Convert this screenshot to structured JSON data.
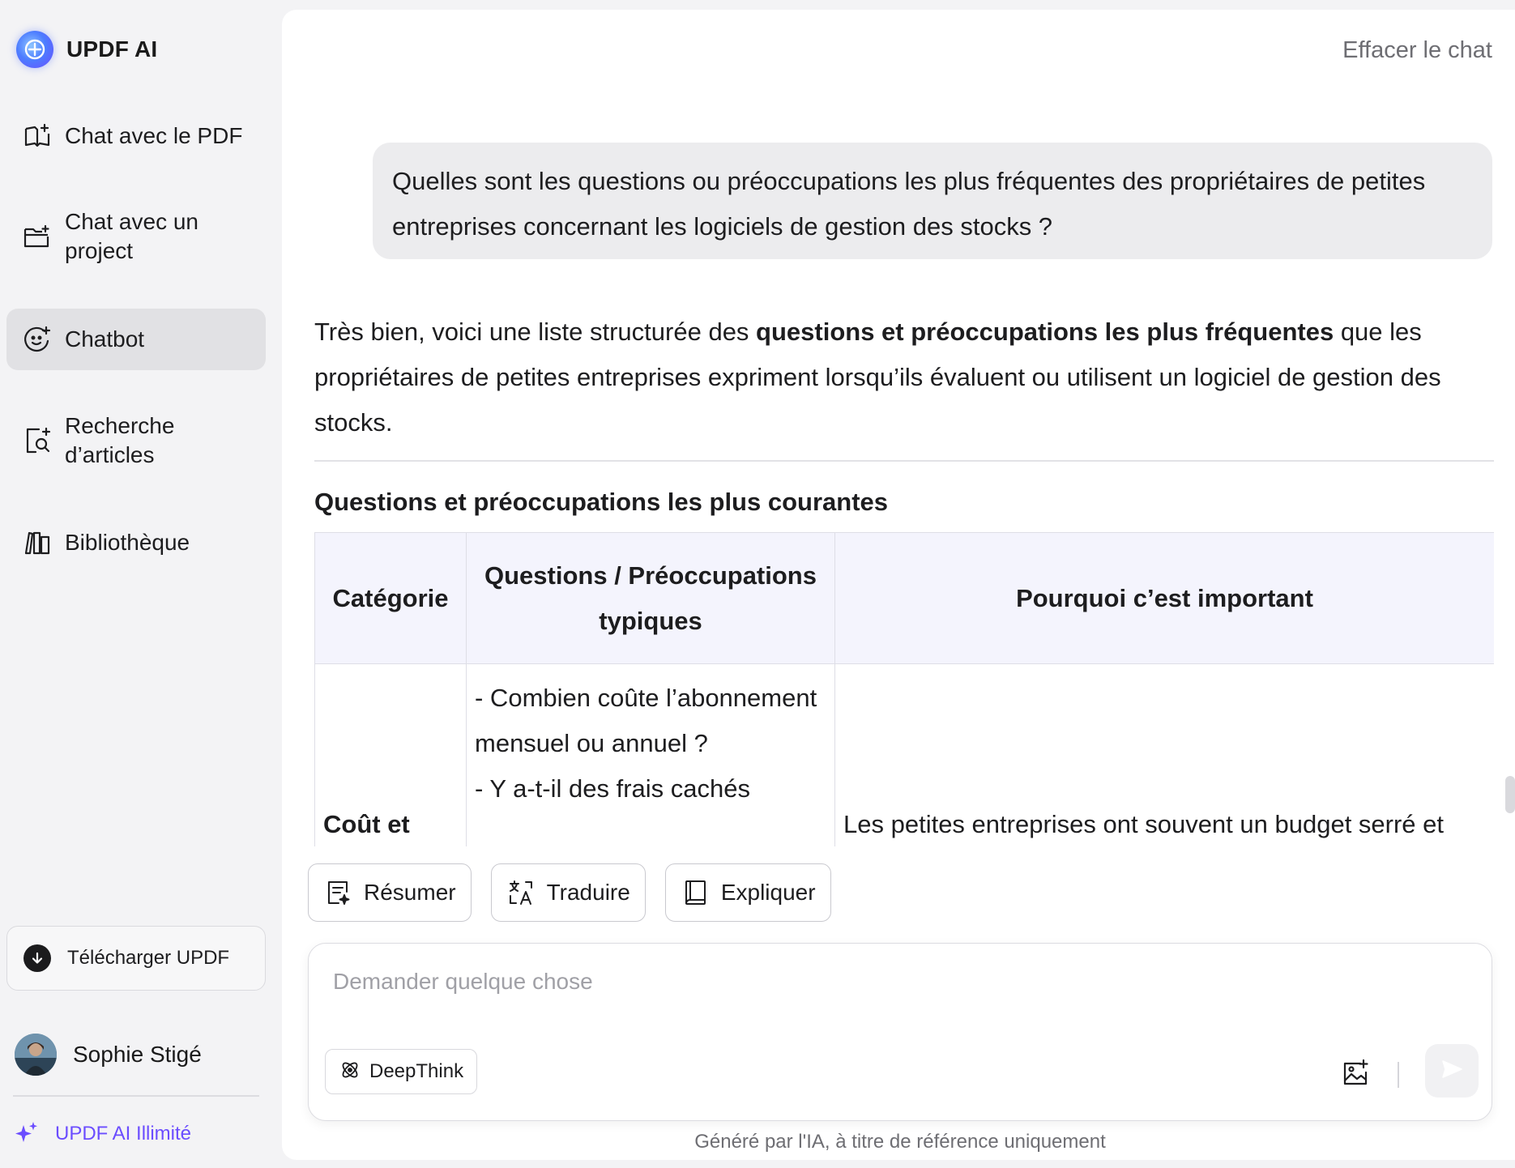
{
  "app": {
    "brand_name": "UPDF AI"
  },
  "sidebar": {
    "items": [
      {
        "label": "Chat avec le PDF",
        "icon": "book-sparkle-icon"
      },
      {
        "label": "Chat avec un project",
        "icon": "folder-sparkle-icon"
      },
      {
        "label": "Chatbot",
        "icon": "bot-face-icon",
        "active": true
      },
      {
        "label": "Recherche d’articles",
        "icon": "document-search-icon"
      },
      {
        "label": "Bibliothèque",
        "icon": "library-icon"
      }
    ],
    "download_label": "Télécharger UPDF",
    "user_name": "Sophie Stigé",
    "upgrade_label": "UPDF AI Illimité"
  },
  "header": {
    "clear_label": "Effacer le chat"
  },
  "conversation": {
    "user_message": "Quelles sont les questions ou préoccupations les plus fréquentes des propriétaires de petites entreprises concernant les logiciels de gestion des stocks ?",
    "ai_intro_before": "Très bien, voici une liste structurée des ",
    "ai_intro_bold": "questions et préoccupations les plus fréquentes",
    "ai_intro_after": " que les propriétaires de petites entreprises expriment lorsqu’ils évaluent ou utilisent un logiciel de gestion des stocks.",
    "section_title": "Questions et préoccupations les plus courantes",
    "table": {
      "headers": [
        "Catégorie",
        "Questions / Préoccupations typiques",
        "Pourquoi c’est important"
      ],
      "rows": [
        {
          "category": "Coût et",
          "questions": [
            "- Combien coûte l’abonnement mensuel ou annuel ?",
            "- Y a-t-il des frais cachés"
          ],
          "why": "Les petites entreprises ont souvent un budget serré et"
        }
      ]
    }
  },
  "actions": {
    "summarize": "Résumer",
    "translate": "Traduire",
    "explain": "Expliquer"
  },
  "composer": {
    "placeholder": "Demander quelque chose",
    "value": "",
    "deepthink_label": "DeepThink"
  },
  "footer": {
    "disclaimer": "Généré par l'IA, à titre de référence uniquement"
  },
  "colors": {
    "accent": "#6b4dff",
    "active_bg": "#e1e1e4",
    "table_header_bg": "#f4f4fd"
  }
}
